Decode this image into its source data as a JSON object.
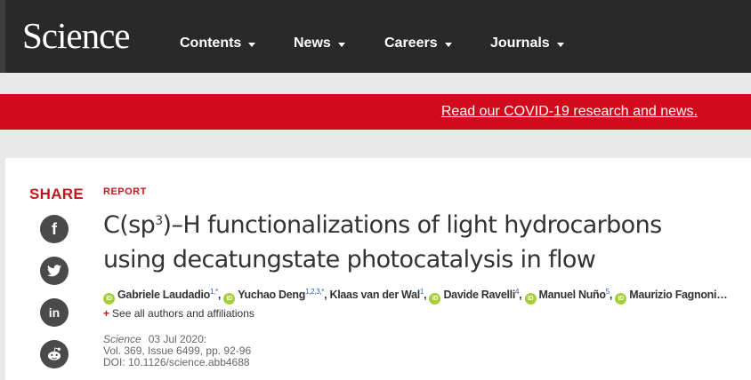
{
  "header": {
    "logo": "Science",
    "nav": [
      {
        "label": "Contents"
      },
      {
        "label": "News"
      },
      {
        "label": "Careers"
      },
      {
        "label": "Journals"
      }
    ]
  },
  "banner": {
    "text": "Read our COVID-19 research and news."
  },
  "sidebar": {
    "share_label": "SHARE",
    "buttons": [
      {
        "icon": "facebook-icon",
        "glyph": "f"
      },
      {
        "icon": "twitter-icon",
        "glyph": "🐦"
      },
      {
        "icon": "linkedin-icon",
        "glyph": "in"
      },
      {
        "icon": "reddit-icon",
        "glyph": "◉"
      }
    ]
  },
  "article": {
    "type": "REPORT",
    "title_part1": "C(sp",
    "title_sup": "3",
    "title_part2": ")–H functionalizations of light hydrocarbons using decatungstate photocatalysis in flow",
    "authors": [
      {
        "name": "Gabriele Laudadio",
        "sup": "1,*",
        "orcid": true,
        "sep": ", "
      },
      {
        "name": "Yuchao Deng",
        "sup": "1,2,3,*",
        "orcid": true,
        "sep": ", "
      },
      {
        "name": "Klaas van der Wal",
        "sup": "1",
        "orcid": false,
        "sep": ", "
      },
      {
        "name": "Davide Ravelli",
        "sup": "4",
        "orcid": true,
        "sep": ", "
      },
      {
        "name": "Manuel Nuño",
        "sup": "5",
        "orcid": true,
        "sep": ", "
      },
      {
        "name": "Maurizio Fagnoni…",
        "sup": "",
        "orcid": true,
        "sep": ""
      }
    ],
    "see_all": "See all authors and affiliations",
    "journal": "Science",
    "date": "03 Jul 2020:",
    "volume": "Vol. 369, Issue 6499, pp. 92-96",
    "doi": "DOI: 10.1126/science.abb4688"
  }
}
